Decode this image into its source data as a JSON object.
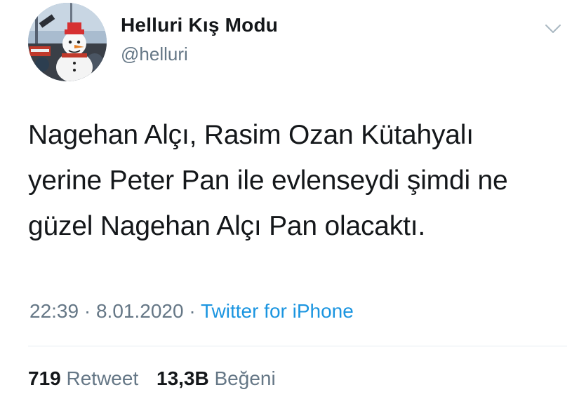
{
  "tweet": {
    "display_name": "Helluri Kış Modu",
    "handle": "@helluri",
    "text_lines": [
      "Nagehan Alçı, Rasim Ozan Kütahyalı",
      "yerine Peter Pan ile evlenseydi şimdi ne",
      "güzel Nagehan Alçı Pan olacaktı."
    ],
    "time": "22:39",
    "separator": "·",
    "date": "8.01.2020",
    "source": "Twitter for iPhone",
    "retweet_count": "719",
    "retweet_label": "Retweet",
    "like_count": "13,3B",
    "like_label": "Beğeni"
  },
  "icons": {
    "menu": "chevron-down-icon"
  },
  "colors": {
    "text": "#14171a",
    "secondary": "#657786",
    "link": "#1b95e0",
    "divider": "#e6ecf0"
  }
}
